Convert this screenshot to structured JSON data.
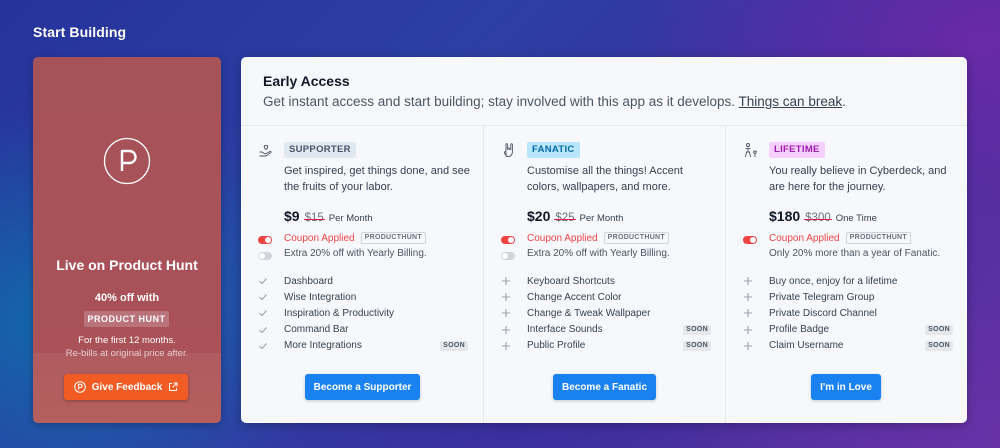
{
  "page_title": "Start Building",
  "product_hunt": {
    "title": "Live on Product Hunt",
    "discount": "40% off with",
    "badge": "PRODUCT HUNT",
    "duration": "For the first 12 months.",
    "rebill": "Re-bills at original price after.",
    "feedback_label": "Give Feedback",
    "colors": {
      "card": "#a65259",
      "button": "#f25b24"
    }
  },
  "early_access": {
    "title": "Early Access",
    "subtitle": "Get instant access and start building; stay involved with this app as it develops.",
    "link_text": "Things can break",
    "subtitle_end": "."
  },
  "tiers": [
    {
      "badge": "SUPPORTER",
      "badge_colors": {
        "bg": "#e2e8f0",
        "fg": "#475569"
      },
      "icon": "hand-heart-icon",
      "description": "Get inspired, get things done, and see the fruits of your labor.",
      "price": "$9",
      "old_price": "$15",
      "period": "Per Month",
      "coupon": "Coupon Applied",
      "coupon_tag": "PRODUCTHUNT",
      "coupon_on": true,
      "extra": "Extra 20% off with Yearly Billing.",
      "extra_on": false,
      "feature_mark": "check-icon",
      "features": [
        {
          "label": "Dashboard",
          "soon": ""
        },
        {
          "label": "Wise Integration",
          "soon": ""
        },
        {
          "label": "Inspiration & Productivity",
          "soon": ""
        },
        {
          "label": "Command Bar",
          "soon": ""
        },
        {
          "label": "More Integrations",
          "soon": "SOON"
        }
      ],
      "cta": "Become a Supporter"
    },
    {
      "badge": "FANATIC",
      "badge_colors": {
        "bg": "#bae6fd",
        "fg": "#0369a1"
      },
      "icon": "rock-hand-icon",
      "description": "Customise all the things! Accent colors, wallpapers, and more.",
      "price": "$20",
      "old_price": "$25",
      "period": "Per Month",
      "coupon": "Coupon Applied",
      "coupon_tag": "PRODUCTHUNT",
      "coupon_on": true,
      "extra": "Extra 20% off with Yearly Billing.",
      "extra_on": false,
      "feature_mark": "plus-icon",
      "features": [
        {
          "label": "Keyboard Shortcuts",
          "soon": ""
        },
        {
          "label": "Change Accent Color",
          "soon": ""
        },
        {
          "label": "Change & Tweak Wallpaper",
          "soon": ""
        },
        {
          "label": "Interface Sounds",
          "soon": "SOON"
        },
        {
          "label": "Public Profile",
          "soon": "SOON"
        }
      ],
      "cta": "Become a Fanatic"
    },
    {
      "badge": "LIFETIME",
      "badge_colors": {
        "bg": "#f5d0fe",
        "fg": "#a21caf"
      },
      "icon": "person-heart-icon",
      "description": "You really believe in Cyberdeck, and are here for the journey.",
      "price": "$180",
      "old_price": "$300",
      "period": "One Time",
      "coupon": "Coupon Applied",
      "coupon_tag": "PRODUCTHUNT",
      "coupon_on": true,
      "extra": "Only 20% more than a year of Fanatic.",
      "extra_on": null,
      "feature_mark": "plus-icon",
      "features": [
        {
          "label": "Buy once, enjoy for a lifetime",
          "soon": ""
        },
        {
          "label": "Private Telegram Group",
          "soon": ""
        },
        {
          "label": "Private Discord Channel",
          "soon": ""
        },
        {
          "label": "Profile Badge",
          "soon": "SOON"
        },
        {
          "label": "Claim Username",
          "soon": "SOON"
        }
      ],
      "cta": "I'm in Love"
    }
  ],
  "colors": {
    "primary_button": "#1a82f0",
    "coupon": "#ef4444"
  }
}
